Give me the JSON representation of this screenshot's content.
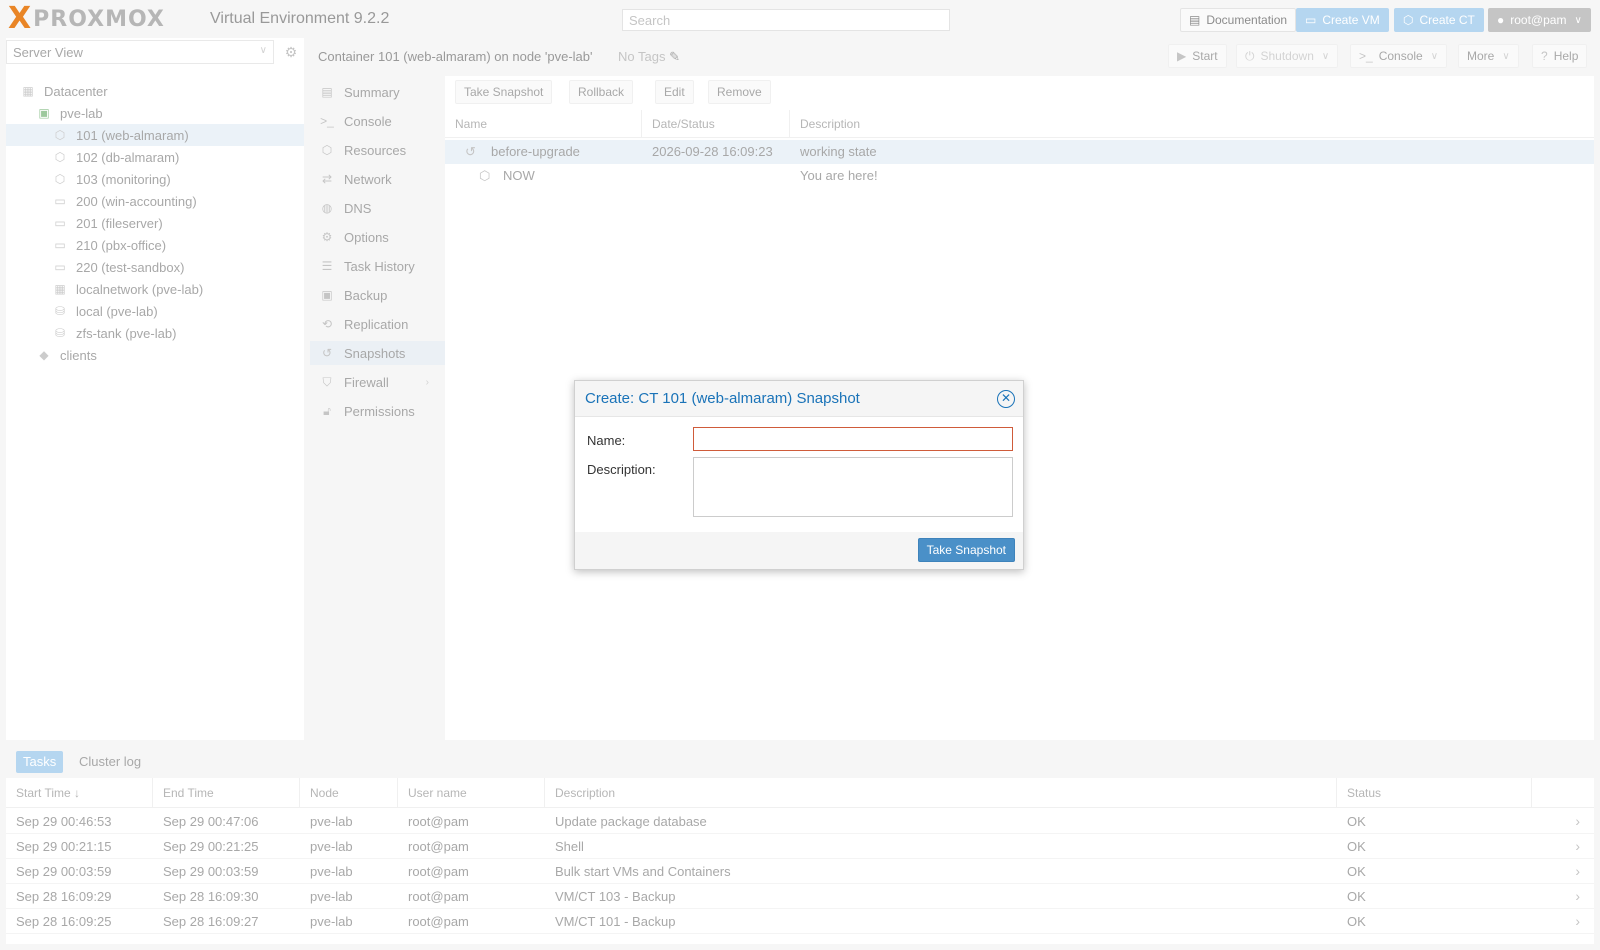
{
  "app": {
    "logo_mark": "X",
    "logo_text": "PROXMOX",
    "version": "Virtual Environment 9.2.2",
    "search_placeholder": "Search",
    "documentation": "Documentation",
    "create_vm": "Create VM",
    "create_ct": "Create CT",
    "user": "root@pam"
  },
  "tree": {
    "view": "Server View",
    "items": [
      {
        "label": "Datacenter",
        "icon": "datacenter-icon"
      },
      {
        "label": "pve-lab",
        "icon": "node-icon"
      },
      {
        "label": "101 (web-almaram)",
        "icon": "container-icon"
      },
      {
        "label": "102 (db-almaram)",
        "icon": "container-icon"
      },
      {
        "label": "103 (monitoring)",
        "icon": "container-icon"
      },
      {
        "label": "200 (win-accounting)",
        "icon": "vm-icon"
      },
      {
        "label": "201 (fileserver)",
        "icon": "vm-icon"
      },
      {
        "label": "210 (pbx-office)",
        "icon": "vm-icon"
      },
      {
        "label": "220 (test-sandbox)",
        "icon": "vm-icon"
      },
      {
        "label": "localnetwork (pve-lab)",
        "icon": "network-grid-icon"
      },
      {
        "label": "local (pve-lab)",
        "icon": "storage-icon"
      },
      {
        "label": "zfs-tank (pve-lab)",
        "icon": "storage-icon"
      },
      {
        "label": "clients",
        "icon": "tags-icon"
      }
    ]
  },
  "content": {
    "title": "Container 101 (web-almaram) on node 'pve-lab'",
    "no_tags": "No Tags",
    "toolbar": {
      "start": "Start",
      "shutdown": "Shutdown",
      "console": "Console",
      "more": "More",
      "help": "Help"
    },
    "nav": [
      {
        "label": "Summary",
        "icon": "book-icon"
      },
      {
        "label": "Console",
        "icon": "terminal-icon"
      },
      {
        "label": "Resources",
        "icon": "cube-icon"
      },
      {
        "label": "Network",
        "icon": "exchange-icon"
      },
      {
        "label": "DNS",
        "icon": "globe-icon"
      },
      {
        "label": "Options",
        "icon": "gear-icon"
      },
      {
        "label": "Task History",
        "icon": "list-icon"
      },
      {
        "label": "Backup",
        "icon": "floppy-icon"
      },
      {
        "label": "Replication",
        "icon": "retweet-icon"
      },
      {
        "label": "Snapshots",
        "icon": "history-icon"
      },
      {
        "label": "Firewall",
        "icon": "shield-icon"
      },
      {
        "label": "Permissions",
        "icon": "unlock-icon"
      }
    ],
    "snapshot_toolbar": {
      "take": "Take Snapshot",
      "rollback": "Rollback",
      "edit": "Edit",
      "remove": "Remove"
    },
    "snapshot_columns": [
      "Name",
      "Date/Status",
      "Description"
    ],
    "snapshots": [
      {
        "name": "before-upgrade",
        "date": "2026-09-28 16:09:23",
        "description": "working state"
      },
      {
        "name": "NOW",
        "date": "",
        "description": "You are here!"
      }
    ]
  },
  "tasks": {
    "tabs": [
      "Tasks",
      "Cluster log"
    ],
    "columns": [
      "Start Time",
      "End Time",
      "Node",
      "User name",
      "Description",
      "Status"
    ],
    "sort_indicator": "↓",
    "rows": [
      {
        "start": "Sep 29 00:46:53",
        "end": "Sep 29 00:47:06",
        "node": "pve-lab",
        "user": "root@pam",
        "desc": "Update package database",
        "status": "OK"
      },
      {
        "start": "Sep 29 00:21:15",
        "end": "Sep 29 00:21:25",
        "node": "pve-lab",
        "user": "root@pam",
        "desc": "Shell",
        "status": "OK"
      },
      {
        "start": "Sep 29 00:03:59",
        "end": "Sep 29 00:03:59",
        "node": "pve-lab",
        "user": "root@pam",
        "desc": "Bulk start VMs and Containers",
        "status": "OK"
      },
      {
        "start": "Sep 28 16:09:29",
        "end": "Sep 28 16:09:30",
        "node": "pve-lab",
        "user": "root@pam",
        "desc": "VM/CT 103 - Backup",
        "status": "OK"
      },
      {
        "start": "Sep 28 16:09:25",
        "end": "Sep 28 16:09:27",
        "node": "pve-lab",
        "user": "root@pam",
        "desc": "VM/CT 101 - Backup",
        "status": "OK"
      }
    ]
  },
  "dialog": {
    "title": "Create: CT 101 (web-almaram) Snapshot",
    "name_label": "Name:",
    "name_value": "",
    "description_label": "Description:",
    "description_value": "",
    "submit": "Take Snapshot"
  },
  "colors": {
    "brand_orange": "#e57000",
    "accent_blue": "#1a73b8",
    "button_blue": "#4a90c8",
    "error_border": "#cf5b3a"
  }
}
